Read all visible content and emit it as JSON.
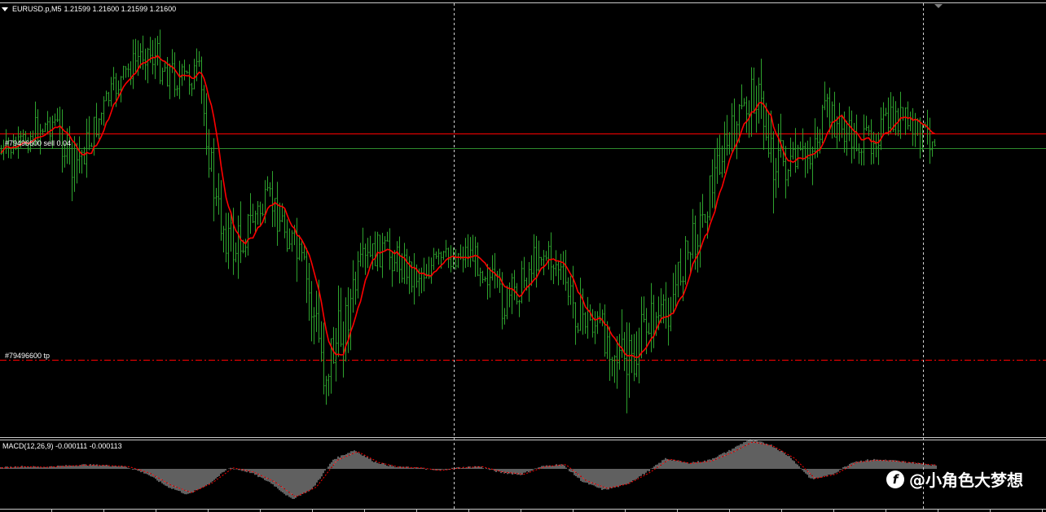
{
  "header": {
    "symbol": "EURUSD.p,M5",
    "ohlc": "1.21599 1.21600 1.21599 1.21600",
    "dropdown_icon": "triangle-down-icon"
  },
  "orders": {
    "sell_label": "#79496600 sell 0.04",
    "tp_label": "#79496600 tp",
    "sell_color": "#ff0000",
    "tp_color": "#ff0000",
    "bid_line_color": "#2e8b2e"
  },
  "macd": {
    "title": "MACD(12,26,9) -0.000111 -0.000113",
    "hist_color": "#c0c0c0",
    "signal_color": "#ff0000"
  },
  "watermark": {
    "text": "@小角色大梦想",
    "icon": "toutiao-logo-icon"
  },
  "colors": {
    "background": "#000000",
    "bars": "#2ea32e",
    "moving_average": "#ff0000",
    "grid": "#c8c8c8"
  },
  "chart_data": {
    "type": "ohlc",
    "symbol": "EURUSD.p",
    "timeframe": "M5",
    "last_ohlc": [
      1.21599,
      1.216,
      1.21599,
      1.216
    ],
    "indicators": [
      "Moving Average",
      "MACD(12,26,9)"
    ],
    "macd_values": {
      "main": -0.000111,
      "signal": -0.000113
    },
    "price_path_relative": [
      0.32,
      0.3,
      0.26,
      0.24,
      0.36,
      0.28,
      0.18,
      0.12,
      0.06,
      0.1,
      0.14,
      0.12,
      0.46,
      0.56,
      0.48,
      0.44,
      0.52,
      0.64,
      0.85,
      0.76,
      0.61,
      0.56,
      0.58,
      0.62,
      0.6,
      0.58,
      0.56,
      0.61,
      0.7,
      0.64,
      0.56,
      0.6,
      0.71,
      0.74,
      0.79,
      0.88,
      0.73,
      0.73,
      0.59,
      0.49,
      0.33,
      0.25,
      0.16,
      0.32,
      0.36,
      0.32,
      0.22,
      0.27,
      0.3,
      0.26,
      0.23,
      0.27,
      0.28
    ],
    "price_noise": [
      0.04,
      0.03,
      0.05,
      0.04,
      0.07,
      0.05,
      0.04,
      0.04,
      0.05,
      0.06,
      0.05,
      0.05,
      0.07,
      0.08,
      0.06,
      0.05,
      0.06,
      0.08,
      0.12,
      0.08,
      0.06,
      0.05,
      0.05,
      0.05,
      0.05,
      0.04,
      0.04,
      0.05,
      0.06,
      0.05,
      0.05,
      0.05,
      0.06,
      0.06,
      0.06,
      0.12,
      0.06,
      0.06,
      0.06,
      0.06,
      0.06,
      0.06,
      0.07,
      0.1,
      0.06,
      0.06,
      0.06,
      0.05,
      0.05,
      0.05,
      0.05,
      0.05,
      0.04
    ],
    "macd_path_relative": [
      0.02,
      0.04,
      0.03,
      0.05,
      0.07,
      0.06,
      0.04,
      -0.08,
      -0.3,
      -0.44,
      -0.26,
      0.02,
      -0.06,
      -0.24,
      -0.52,
      -0.34,
      0.16,
      0.32,
      0.12,
      0.03,
      0.02,
      -0.03,
      0.02,
      0.04,
      -0.06,
      -0.1,
      0.04,
      0.08,
      -0.22,
      -0.36,
      -0.28,
      -0.08,
      0.18,
      0.1,
      0.14,
      0.3,
      0.5,
      0.42,
      0.2,
      -0.18,
      -0.1,
      0.12,
      0.16,
      0.14,
      0.1,
      0.06
    ]
  }
}
